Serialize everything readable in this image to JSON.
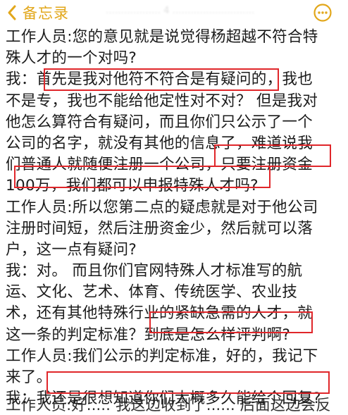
{
  "nav": {
    "back_label": "备忘录",
    "ghost_text": "……………… 4   ………………………",
    "icons": {
      "back": "chevron-left-icon",
      "more": "more-circle-icon"
    },
    "accent_color": "#e2a71b"
  },
  "highlight_color": "#e0262a",
  "note": {
    "lines": [
      "工作人员:您的意见就是说觉得杨超越不符合特",
      "殊人才的一个对吗?",
      "我：首先是我对他符不符合是有疑问的，我也",
      "不是专，我也不能给他定性对不对？ 但是我对",
      "他怎么算符合有疑问，而且你们只公示了一个",
      "公司的名字，就没有其他的信息了，难道说我",
      "们普通人就随便注册一个公司，只要注册资金",
      "100万，我们都可以申报特殊人才吗?",
      "工作人员:所以您第二点的疑虑就是对于他公司",
      "注册时间短，然后注册资金少，然后就可以落",
      "户，这一点有疑问?",
      "我：对。 而且你们官网特殊人才标准写的航",
      "运、文化、艺术、体育、传统医学、农业技",
      "术，还有其他特殊行业的紧缺急需的人才，就",
      "这一条的判定标准？到底是怎么样评判啊?",
      "工作人员:我们公示的判定标准，好的，我记下",
      "来了。",
      "我：我还是很想知道你们大概多久能给个回复?"
    ],
    "cutoff_line": "工作人员:好..... 我这边收到了...... 后面这边会反"
  }
}
